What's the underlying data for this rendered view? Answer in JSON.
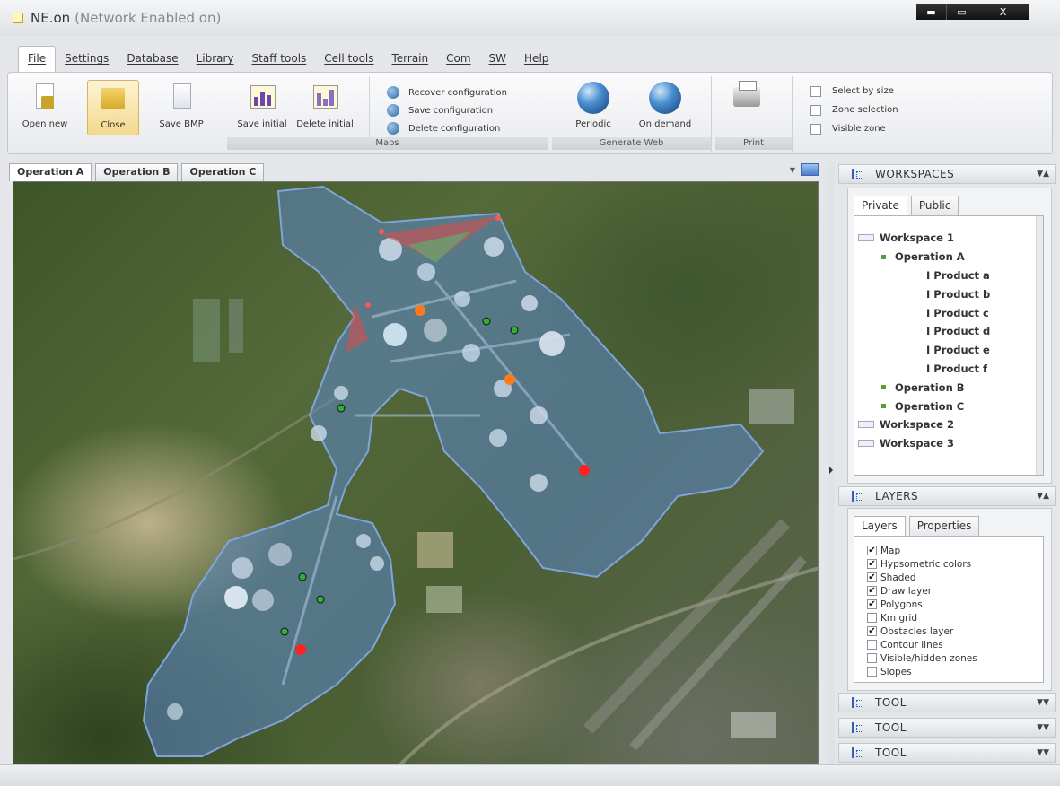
{
  "window": {
    "title": "NE.on",
    "subtitle": "(Network Enabled on)",
    "minimize": "▬",
    "maximize": "▭",
    "close": "X"
  },
  "menu": {
    "items": [
      "File",
      "Settings",
      "Database",
      "Library",
      "Staff tools",
      "Cell tools",
      "Terrain",
      "Com",
      "SW",
      "Help"
    ],
    "active": "File"
  },
  "ribbon": {
    "open_new": "Open new",
    "close": "Close",
    "save_bmp": "Save BMP",
    "save_initial": "Save initial",
    "delete_initial": "Delete initial",
    "maps_label": "Maps",
    "recover_config": "Recover configuration",
    "save_config": "Save configuration",
    "delete_config": "Delete configuration",
    "periodic": "Periodic",
    "on_demand": "On demand",
    "generate_web_label": "Generate Web",
    "print_label": "Print",
    "select_by_size": "Select by size",
    "zone_selection": "Zone selection",
    "visible_zone": "Visible zone"
  },
  "doc_tabs": [
    "Operation A",
    "Operation B",
    "Operation C"
  ],
  "workspaces": {
    "title": "WORKSPACES",
    "tabs": [
      "Private",
      "Public"
    ],
    "tree": {
      "ws1": "Workspace 1",
      "opA": "Operation A",
      "products": [
        "I Product a",
        "I Product b",
        "I Product c",
        "I Product d",
        "I Product e",
        "I Product f"
      ],
      "opB": "Operation B",
      "opC": "Operation C",
      "ws2": "Workspace 2",
      "ws3": "Workspace 3"
    }
  },
  "layers": {
    "title": "LAYERS",
    "tabs": [
      "Layers",
      "Properties"
    ],
    "items": [
      {
        "label": "Map",
        "checked": true
      },
      {
        "label": "Hypsometric colors",
        "checked": true
      },
      {
        "label": "Shaded",
        "checked": true
      },
      {
        "label": "Draw layer",
        "checked": true
      },
      {
        "label": "Polygons",
        "checked": true
      },
      {
        "label": "Km grid",
        "checked": false
      },
      {
        "label": "Obstacles layer",
        "checked": true
      },
      {
        "label": "Contour lines",
        "checked": false
      },
      {
        "label": "Visible/hidden zones",
        "checked": false
      },
      {
        "label": "Slopes",
        "checked": false
      }
    ]
  },
  "tools": [
    "TOOL",
    "TOOL",
    "TOOL"
  ],
  "colors": {
    "zone_fill": "#5b86c8",
    "marker_red": "#ff2020",
    "marker_orange": "#ff7a1a",
    "marker_green": "#2fae3a"
  }
}
